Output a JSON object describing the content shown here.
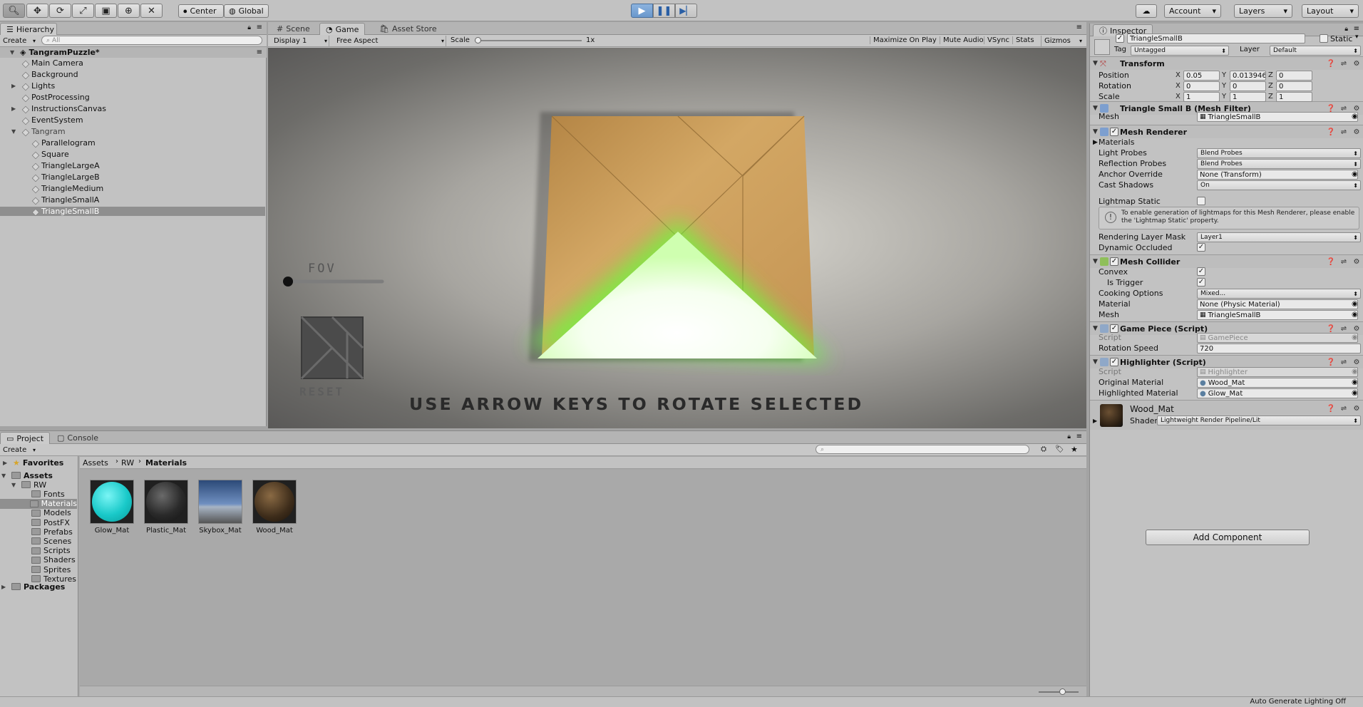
{
  "toolbar": {
    "tools": [
      "hand-tool",
      "move-tool",
      "rotate-tool",
      "scale-tool",
      "rect-tool",
      "transform-tool",
      "custom-tool"
    ],
    "pivot": "Center",
    "space": "Global",
    "account": "Account",
    "layers": "Layers",
    "layout": "Layout"
  },
  "hierarchy": {
    "tab": "Hierarchy",
    "create": "Create",
    "search_placeholder": "All",
    "scene": "TangramPuzzle*",
    "items": [
      {
        "label": "Main Camera",
        "expandable": false,
        "indent": 1
      },
      {
        "label": "Background",
        "expandable": false,
        "indent": 1
      },
      {
        "label": "Lights",
        "expandable": true,
        "indent": 1
      },
      {
        "label": "PostProcessing",
        "expandable": false,
        "indent": 1
      },
      {
        "label": "InstructionsCanvas",
        "expandable": true,
        "indent": 1
      },
      {
        "label": "EventSystem",
        "expandable": false,
        "indent": 1
      },
      {
        "label": "Tangram",
        "expandable": true,
        "indent": 1,
        "expanded": true
      },
      {
        "label": "Parallelogram",
        "expandable": false,
        "indent": 2
      },
      {
        "label": "Square",
        "expandable": false,
        "indent": 2
      },
      {
        "label": "TriangleLargeA",
        "expandable": false,
        "indent": 2
      },
      {
        "label": "TriangleLargeB",
        "expandable": false,
        "indent": 2
      },
      {
        "label": "TriangleMedium",
        "expandable": false,
        "indent": 2
      },
      {
        "label": "TriangleSmallA",
        "expandable": false,
        "indent": 2
      },
      {
        "label": "TriangleSmallB",
        "expandable": false,
        "indent": 2,
        "selected": true
      }
    ]
  },
  "center_tabs": {
    "scene": "Scene",
    "game": "Game",
    "asset_store": "Asset Store"
  },
  "game_bar": {
    "display": "Display 1",
    "aspect": "Free Aspect",
    "scale_label": "Scale",
    "scale_value": "1x",
    "maximize": "Maximize On Play",
    "mute": "Mute Audio",
    "vsync": "VSync",
    "stats": "Stats",
    "gizmos": "Gizmos"
  },
  "game_view": {
    "fov_label": "FOV",
    "fov_value": 0.0,
    "reset_label": "RESET",
    "instructions": "USE ARROW KEYS TO ROTATE SELECTED"
  },
  "project": {
    "tab": "Project",
    "console_tab": "Console",
    "create": "Create",
    "favorites": "Favorites",
    "tree": [
      {
        "label": "Assets",
        "level": 0,
        "bold": true
      },
      {
        "label": "RW",
        "level": 1
      },
      {
        "label": "Fonts",
        "level": 2
      },
      {
        "label": "Materials",
        "level": 2,
        "selected": true
      },
      {
        "label": "Models",
        "level": 2
      },
      {
        "label": "PostFX",
        "level": 2
      },
      {
        "label": "Prefabs",
        "level": 2
      },
      {
        "label": "Scenes",
        "level": 2
      },
      {
        "label": "Scripts",
        "level": 2
      },
      {
        "label": "Shaders",
        "level": 2
      },
      {
        "label": "Sprites",
        "level": 2
      },
      {
        "label": "Textures",
        "level": 2
      },
      {
        "label": "Packages",
        "level": 0,
        "bold": true
      }
    ],
    "breadcrumb": [
      "Assets",
      "RW",
      "Materials"
    ],
    "assets": [
      {
        "label": "Glow_Mat",
        "kind": "glow"
      },
      {
        "label": "Plastic_Mat",
        "kind": "plastic"
      },
      {
        "label": "Skybox_Mat",
        "kind": "skybox"
      },
      {
        "label": "Wood_Mat",
        "kind": "wood"
      }
    ]
  },
  "inspector": {
    "tab": "Inspector",
    "object_name": "TriangleSmallB",
    "static_label": "Static",
    "tag_label": "Tag",
    "tag_value": "Untagged",
    "layer_label": "Layer",
    "layer_value": "Default",
    "transform": {
      "title": "Transform",
      "position": {
        "label": "Position",
        "x": "0.05",
        "y": "0.0139461",
        "z": "0"
      },
      "rotation": {
        "label": "Rotation",
        "x": "0",
        "y": "0",
        "z": "0"
      },
      "scale": {
        "label": "Scale",
        "x": "1",
        "y": "1",
        "z": "1"
      }
    },
    "mesh_filter": {
      "title": "Triangle Small B (Mesh Filter)",
      "mesh_label": "Mesh",
      "mesh_value": "TriangleSmallB"
    },
    "mesh_renderer": {
      "title": "Mesh Renderer",
      "materials_label": "Materials",
      "light_probes_label": "Light Probes",
      "light_probes_value": "Blend Probes",
      "reflection_probes_label": "Reflection Probes",
      "reflection_probes_value": "Blend Probes",
      "anchor_label": "Anchor Override",
      "anchor_value": "None (Transform)",
      "cast_label": "Cast Shadows",
      "cast_value": "On",
      "lightmap_label": "Lightmap Static",
      "info": "To enable generation of lightmaps for this Mesh Renderer, please enable the 'Lightmap Static' property.",
      "layer_mask_label": "Rendering Layer Mask",
      "layer_mask_value": "Layer1",
      "occluded_label": "Dynamic Occluded"
    },
    "mesh_collider": {
      "title": "Mesh Collider",
      "convex_label": "Convex",
      "trigger_label": "Is Trigger",
      "cooking_label": "Cooking Options",
      "cooking_value": "Mixed...",
      "material_label": "Material",
      "material_value": "None (Physic Material)",
      "mesh_label": "Mesh",
      "mesh_value": "TriangleSmallB"
    },
    "game_piece": {
      "title": "Game Piece (Script)",
      "script_label": "Script",
      "script_value": "GamePiece",
      "speed_label": "Rotation Speed",
      "speed_value": "720"
    },
    "highlighter": {
      "title": "Highlighter (Script)",
      "script_label": "Script",
      "script_value": "Highlighter",
      "original_label": "Original Material",
      "original_value": "Wood_Mat",
      "highlighted_label": "Highlighted Material",
      "highlighted_value": "Glow_Mat"
    },
    "material": {
      "name": "Wood_Mat",
      "shader_label": "Shader",
      "shader_value": "Lightweight Render Pipeline/Lit"
    },
    "add_component": "Add Component"
  },
  "status": {
    "text": "Auto Generate Lighting Off"
  },
  "colors": {
    "play_blue": "#6a98cc",
    "glow_green": "#7cff5a",
    "wood": "#c79a55",
    "selection": "#8f8f8f"
  }
}
